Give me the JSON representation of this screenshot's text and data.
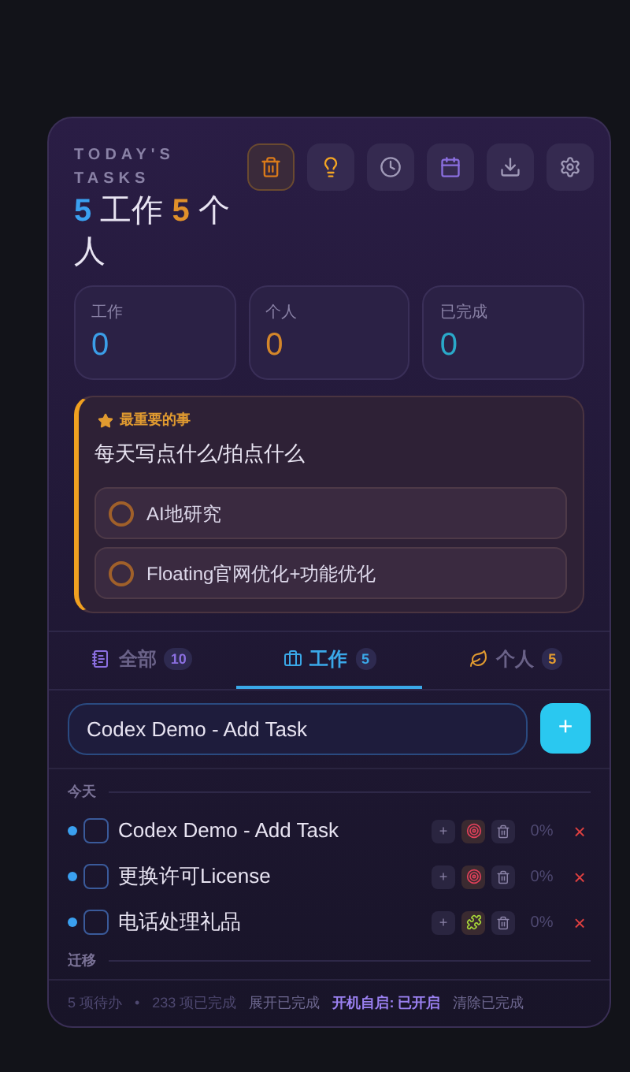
{
  "header": {
    "title": "TODAY'S TASKS",
    "work_count": "5",
    "work_label": "工作",
    "personal_count": "5",
    "personal_label": "个人"
  },
  "toolbar": [
    {
      "kind": "trash",
      "active": true
    },
    {
      "kind": "bulb",
      "active": false
    },
    {
      "kind": "clock",
      "active": false
    },
    {
      "kind": "calendar",
      "active": false
    },
    {
      "kind": "download",
      "active": false
    },
    {
      "kind": "settings",
      "active": false
    }
  ],
  "stats": [
    {
      "label": "工作",
      "value": "0",
      "color": "#3b9ee8"
    },
    {
      "label": "个人",
      "value": "0",
      "color": "#d4862a"
    },
    {
      "label": "已完成",
      "value": "0",
      "color": "#2aa9c9"
    }
  ],
  "focus": {
    "label": "最重要的事",
    "text": "每天写点什么/拍点什么",
    "items": [
      {
        "text": "AI地研究"
      },
      {
        "text": "Floating官网优化+功能优化"
      }
    ]
  },
  "tabs": [
    {
      "label": "全部",
      "count": "10",
      "kind": "note",
      "selected": false,
      "color": "#8b6fe0"
    },
    {
      "label": "工作",
      "count": "5",
      "kind": "briefcase",
      "selected": true,
      "color": "#3aa8e8"
    },
    {
      "label": "个人",
      "count": "5",
      "kind": "leaf",
      "selected": false,
      "color": "#e09a30"
    }
  ],
  "new_task": {
    "value": "Codex Demo - Add Task",
    "button": "+"
  },
  "sections": [
    {
      "title": "今天",
      "tasks": [
        {
          "text": "Codex Demo - Add Task",
          "checked": false,
          "kind": "target",
          "progress": "0%",
          "add": "+",
          "remove": "×"
        },
        {
          "text": "更换许可License",
          "checked": false,
          "kind": "target",
          "progress": "0%",
          "add": "+",
          "remove": "×"
        },
        {
          "text": "电话处理礼品",
          "checked": false,
          "kind": "puzzle",
          "progress": "0%",
          "add": "+",
          "remove": "×"
        }
      ]
    },
    {
      "title": "迁移"
    }
  ],
  "footer": {
    "pending": "5 项待办",
    "separator": "•",
    "done": "233 项已完成",
    "expand": "展开已完成",
    "autostart": "开机自启: 已开启",
    "clear": "清除已完成"
  }
}
